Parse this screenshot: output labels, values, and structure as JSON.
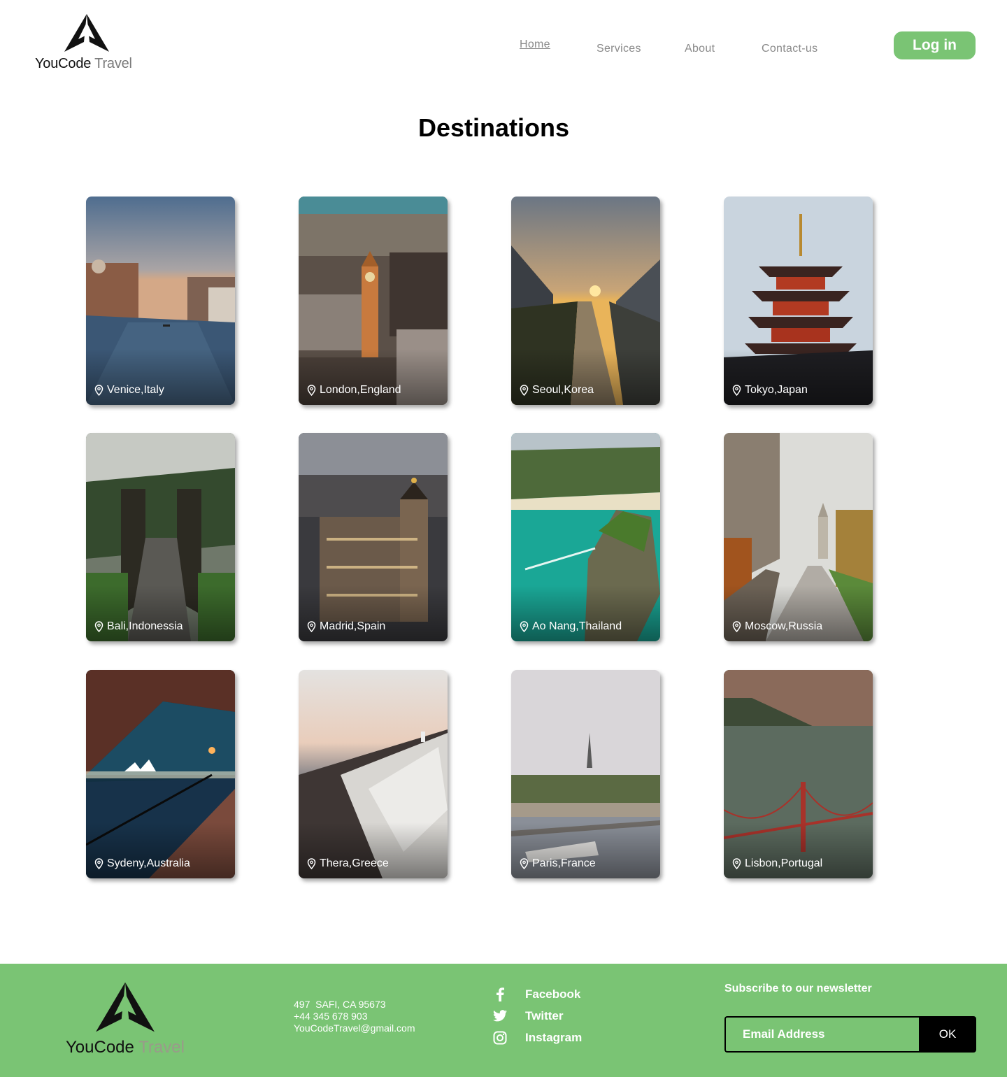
{
  "header": {
    "logo": {
      "brand_dark": "YouCode",
      "brand_light": "Travel"
    },
    "nav": [
      {
        "label": "Home",
        "active": true
      },
      {
        "label": "Services",
        "active": false
      },
      {
        "label": "About",
        "active": false
      },
      {
        "label": "Contact-us",
        "active": false
      }
    ],
    "login_label": "Log in"
  },
  "main": {
    "title": "Destinations",
    "destinations": [
      {
        "location": "Venice,Italy",
        "scene": "canal"
      },
      {
        "location": "London,England",
        "scene": "city-tower"
      },
      {
        "location": "Seoul,Korea",
        "scene": "sunset-stream"
      },
      {
        "location": "Tokyo,Japan",
        "scene": "pagoda"
      },
      {
        "location": "Bali,Indonessia",
        "scene": "temple-gate"
      },
      {
        "location": "Madrid,Spain",
        "scene": "night-city"
      },
      {
        "location": "Ao Nang,Thailand",
        "scene": "tropical-bay"
      },
      {
        "location": "Moscow,Russia",
        "scene": "autumn-walk"
      },
      {
        "location": "Sydeny,Australia",
        "scene": "harbour-night"
      },
      {
        "location": "Thera,Greece",
        "scene": "white-village"
      },
      {
        "location": "Paris,France",
        "scene": "river-eiffel"
      },
      {
        "location": "Lisbon,Portugal",
        "scene": "red-bridge"
      }
    ]
  },
  "footer": {
    "logo": {
      "brand_dark": "YouCode",
      "brand_light": "Travel"
    },
    "contact": {
      "address": "497  SAFI, CA 95673",
      "phone": "+44 345 678 903",
      "email": "YouCodeTravel@gmail.com"
    },
    "social": [
      {
        "label": "Facebook",
        "icon": "facebook-icon"
      },
      {
        "label": "Twitter",
        "icon": "twitter-icon"
      },
      {
        "label": "Instagram",
        "icon": "instagram-icon"
      }
    ],
    "newsletter": {
      "title": "Subscribe to our newsletter",
      "placeholder": "Email Address",
      "button_label": "OK"
    }
  },
  "colors": {
    "accent": "#7ac474",
    "text": "#000000",
    "nav": "#8a8a8a"
  }
}
